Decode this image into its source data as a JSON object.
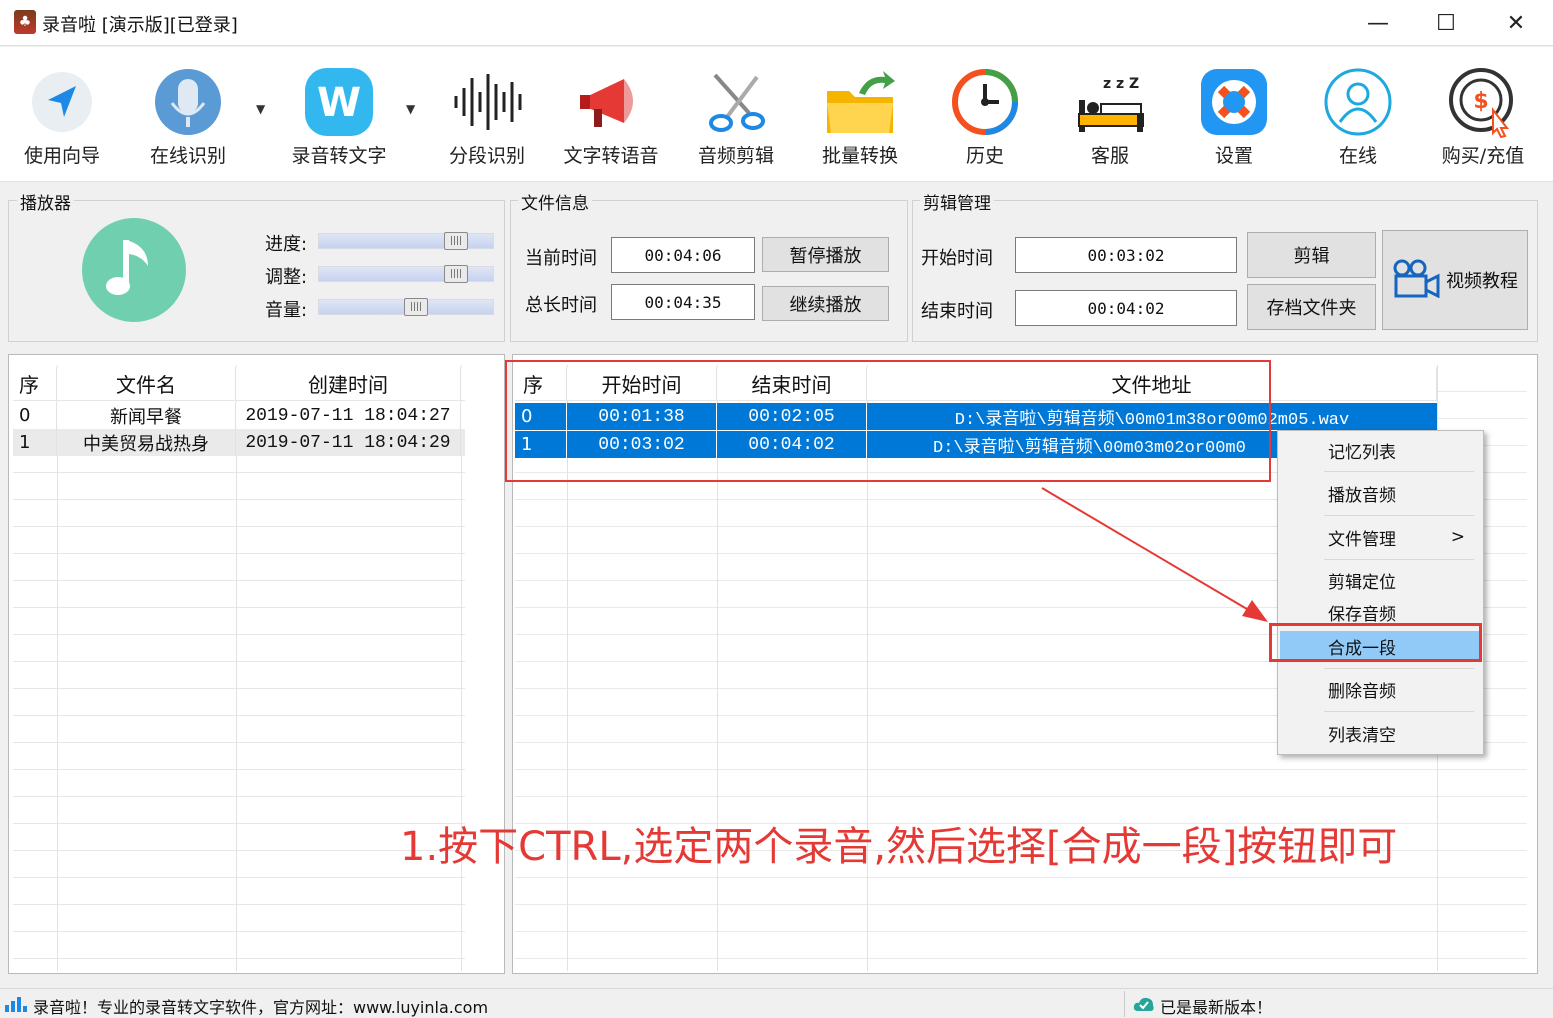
{
  "window": {
    "title": "录音啦 [演示版][已登录]",
    "minimize": "—",
    "maximize": "☐",
    "close": "✕"
  },
  "toolbar": {
    "items": [
      {
        "label": "使用向导",
        "icon": "navigation-arrow-icon"
      },
      {
        "label": "在线识别",
        "icon": "microphone-icon"
      },
      {
        "label": "录音转文字",
        "icon": "w-logo-icon"
      },
      {
        "label": "分段识别",
        "icon": "waveform-icon"
      },
      {
        "label": "文字转语音",
        "icon": "megaphone-icon"
      },
      {
        "label": "音频剪辑",
        "icon": "scissors-icon"
      },
      {
        "label": "批量转换",
        "icon": "folder-arrow-icon"
      },
      {
        "label": "历史",
        "icon": "clock-history-icon"
      },
      {
        "label": "客服",
        "icon": "sleeping-bed-icon"
      },
      {
        "label": "设置",
        "icon": "lifebuoy-icon"
      },
      {
        "label": "在线",
        "icon": "user-circle-icon"
      },
      {
        "label": "购买/充值",
        "icon": "dollar-coin-icon"
      }
    ],
    "dropdown_glyph": "▼"
  },
  "player": {
    "title": "播放器",
    "progress_label": "进度:",
    "adjust_label": "调整:",
    "volume_label": "音量:",
    "progress": 0.83,
    "adjust": 0.83,
    "volume": 0.57
  },
  "file_info": {
    "title": "文件信息",
    "current_label": "当前时间",
    "current_value": "00:04:06",
    "total_label": "总长时间",
    "total_value": "00:04:35",
    "pause_button": "暂停播放",
    "resume_button": "继续播放"
  },
  "edit": {
    "title": "剪辑管理",
    "start_label": "开始时间",
    "start_value": "00:03:02",
    "end_label": "结束时间",
    "end_value": "00:04:02",
    "cut_button": "剪辑",
    "archive_button": "存档文件夹",
    "video_button": "视频教程"
  },
  "file_list": {
    "headers": [
      "序",
      "文件名",
      "创建时间"
    ],
    "rows": [
      [
        "0",
        "新闻早餐",
        "2019-07-11 18:04:27"
      ],
      [
        "1",
        "中美贸易战热身",
        "2019-07-11 18:04:29"
      ]
    ]
  },
  "clip_list": {
    "headers": [
      "序",
      "开始时间",
      "结束时间",
      "文件地址"
    ],
    "rows": [
      [
        "0",
        "00:01:38",
        "00:02:05",
        "D:\\录音啦\\剪辑音频\\00m01m38or00m02m05.wav"
      ],
      [
        "1",
        "00:03:02",
        "00:04:02",
        "D:\\录音啦\\剪辑音频\\00m03m02or00m0"
      ]
    ]
  },
  "context_menu": {
    "items": [
      "记忆列表",
      "播放音频",
      "文件管理",
      "剪辑定位",
      "保存音频",
      "合成一段",
      "删除音频",
      "列表清空"
    ],
    "submenu_arrow": ">"
  },
  "annotation": {
    "text": "1.按下CTRL,选定两个录音,然后选择[合成一段]按钮即可",
    "color": "#e53935"
  },
  "status": {
    "left": "录音啦！专业的录音转文字软件，官方网址：www.luyinla.com",
    "right": "已是最新版本！"
  }
}
